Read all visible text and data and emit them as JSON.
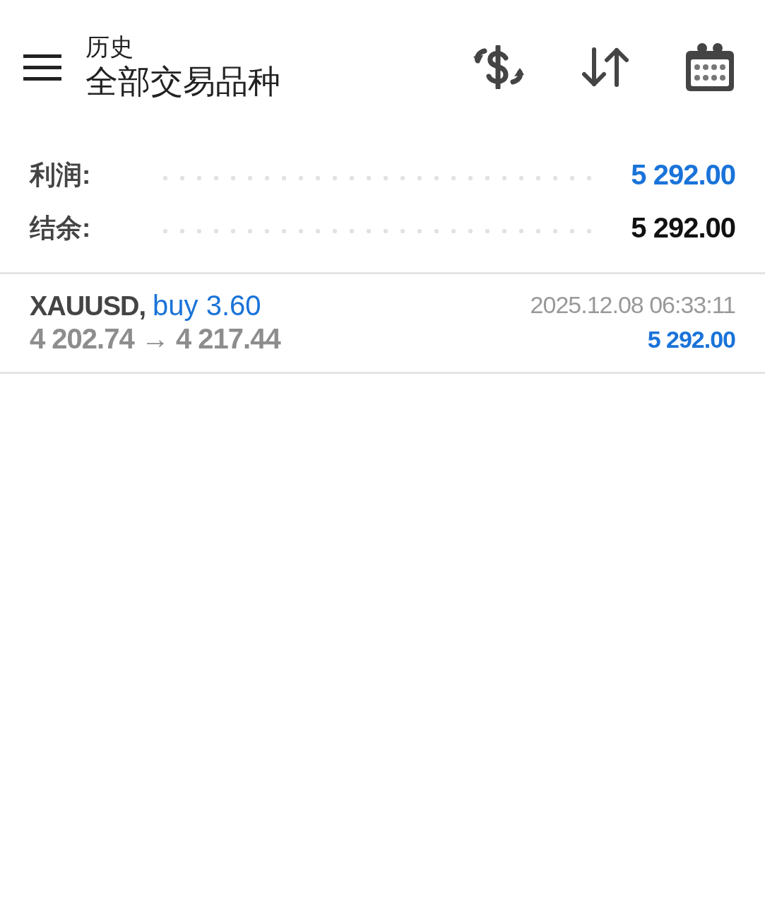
{
  "header": {
    "title": "历史",
    "subtitle": "全部交易品种"
  },
  "summary": [
    {
      "label": "利润:",
      "value": "5 292.00",
      "color": "#1a73d9"
    },
    {
      "label": "结余:",
      "value": "5 292.00",
      "color": "#111111"
    }
  ],
  "deals": [
    {
      "symbol": "XAUUSD,",
      "side": "buy 3.60",
      "prices": "4 202.74 → 4 217.44",
      "time": "2025.12.08 06:33:11",
      "profit": "5 292.00"
    }
  ]
}
